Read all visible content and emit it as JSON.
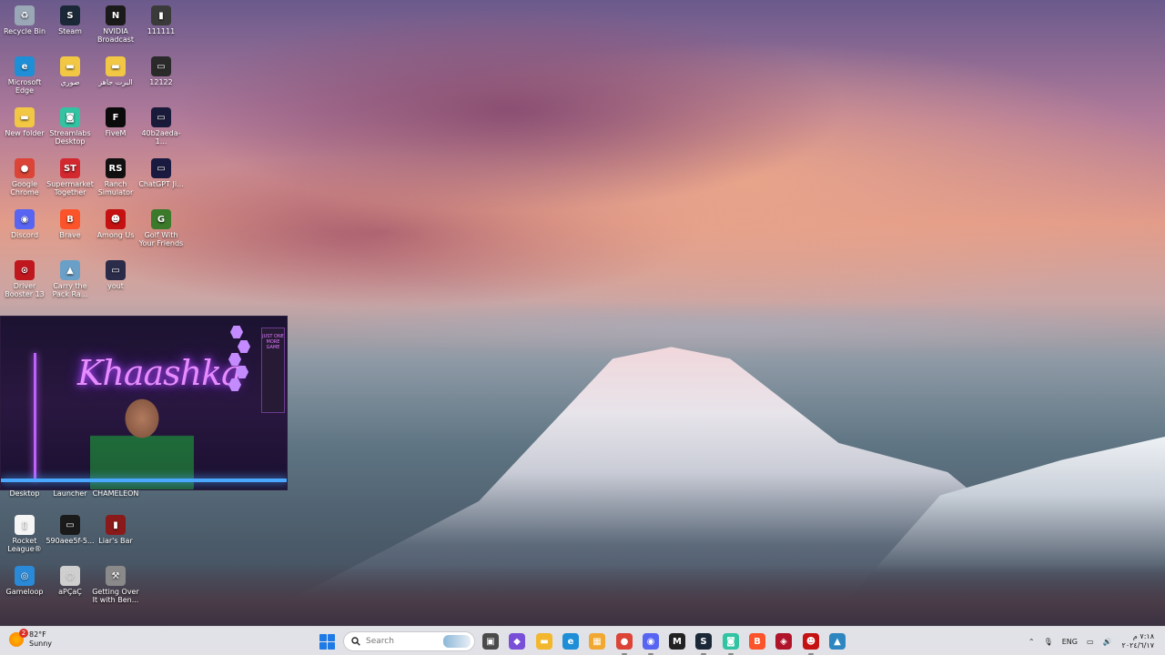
{
  "desktop": {
    "col1": [
      {
        "name": "recycle-bin",
        "label": "Recycle Bin",
        "glyph": "♻",
        "color": "#9aa7b6"
      },
      {
        "name": "microsoft-edge",
        "label": "Microsoft Edge",
        "glyph": "e",
        "color": "#1e8fd6"
      },
      {
        "name": "new-folder",
        "label": "New folder",
        "glyph": "▬",
        "color": "#f2c744"
      },
      {
        "name": "google-chrome",
        "label": "Google Chrome",
        "glyph": "●",
        "color": "#db4437"
      },
      {
        "name": "discord",
        "label": "Discord",
        "glyph": "◉",
        "color": "#5865f2"
      },
      {
        "name": "driver-booster",
        "label": "Driver Booster 13",
        "glyph": "⊙",
        "color": "#c0171f"
      }
    ],
    "col2": [
      {
        "name": "steam",
        "label": "Steam",
        "glyph": "S",
        "color": "#1b2838"
      },
      {
        "name": "folder-sowari",
        "label": "صوري",
        "glyph": "▬",
        "color": "#f2c744"
      },
      {
        "name": "streamlabs",
        "label": "Streamlabs Desktop",
        "glyph": "◙",
        "color": "#31c3a2"
      },
      {
        "name": "supermarket-together",
        "label": "Supermarket Together",
        "glyph": "ST",
        "color": "#d3282f"
      },
      {
        "name": "brave",
        "label": "Brave",
        "glyph": "B",
        "color": "#fb542b"
      },
      {
        "name": "carry-the-pack",
        "label": "Carry the Pack Ra...",
        "glyph": "▲",
        "color": "#6aa0c8"
      }
    ],
    "col3": [
      {
        "name": "nvidia-broadcast",
        "label": "NVIDIA Broadcast",
        "glyph": "N",
        "color": "#1a1a1a"
      },
      {
        "name": "folder-albirt",
        "label": "البرت جاهز",
        "glyph": "▬",
        "color": "#f2c744"
      },
      {
        "name": "fivem",
        "label": "FiveM",
        "glyph": "F",
        "color": "#0b0b0b"
      },
      {
        "name": "ranch-simulator",
        "label": "Ranch Simulator",
        "glyph": "RS",
        "color": "#111111"
      },
      {
        "name": "among-us",
        "label": "Among Us",
        "glyph": "☻",
        "color": "#c51111"
      },
      {
        "name": "yout",
        "label": "yout",
        "glyph": "▭",
        "color": "#2b2b4a"
      }
    ],
    "col4": [
      {
        "name": "file-111111",
        "label": "111111",
        "glyph": "▮",
        "color": "#3a3a3a"
      },
      {
        "name": "file-12122",
        "label": "12122",
        "glyph": "▭",
        "color": "#2a2a2a"
      },
      {
        "name": "file-40b",
        "label": "40b2aeda-1...",
        "glyph": "▭",
        "color": "#1a1a3a"
      },
      {
        "name": "chatgpt",
        "label": "ChatGPT Ji...",
        "glyph": "▭",
        "color": "#1a1a40"
      },
      {
        "name": "golf-with-friends",
        "label": "Golf With Your Friends",
        "glyph": "G",
        "color": "#3a7a2a"
      }
    ],
    "lower": [
      {
        "name": "desktop-partial",
        "label": "Desktop",
        "glyph": "",
        "color": "transparent"
      },
      {
        "name": "epic-launcher",
        "label": "Launcher",
        "glyph": "",
        "color": "transparent"
      },
      {
        "name": "chameleon",
        "label": "CHAMELEON",
        "glyph": "",
        "color": "transparent"
      },
      {
        "name": "rocket-league",
        "label": "Rocket League®",
        "glyph": "▯",
        "color": "#f5f5f5"
      },
      {
        "name": "file-590aee",
        "label": "590aee5f-5...",
        "glyph": "▭",
        "color": "#1a1a1a"
      },
      {
        "name": "liars-bar",
        "label": "Liar's Bar",
        "glyph": "▮",
        "color": "#8a1a1a"
      },
      {
        "name": "gameloop",
        "label": "Gameloop",
        "glyph": "◎",
        "color": "#2a8ad8"
      },
      {
        "name": "apcac",
        "label": "aPÇaÇ",
        "glyph": "◌",
        "color": "#cfcfcf"
      },
      {
        "name": "getting-over-it",
        "label": "Getting Over It with Ben...",
        "glyph": "⚒",
        "color": "#8a8a8a"
      }
    ]
  },
  "webcam": {
    "sign": "Khaashka",
    "poster": "JUST ONE MORE GAME"
  },
  "taskbar": {
    "weather_temp": "82°F",
    "weather_cond": "Sunny",
    "weather_badge": "2",
    "search_placeholder": "Search",
    "apps": [
      {
        "name": "task-view",
        "glyph": "▣",
        "color": "#4a4a4a"
      },
      {
        "name": "microsoft-365",
        "glyph": "◆",
        "color": "#7a4fd8"
      },
      {
        "name": "file-explorer",
        "glyph": "▬",
        "color": "#f2b72c"
      },
      {
        "name": "edge",
        "glyph": "e",
        "color": "#1e8fd6"
      },
      {
        "name": "store",
        "glyph": "▦",
        "color": "#f0a830"
      },
      {
        "name": "chrome",
        "glyph": "●",
        "color": "#db4437"
      },
      {
        "name": "discord",
        "glyph": "◉",
        "color": "#5865f2"
      },
      {
        "name": "epic",
        "glyph": "M",
        "color": "#222222"
      },
      {
        "name": "steam",
        "glyph": "S",
        "color": "#1b2838"
      },
      {
        "name": "streamlabs",
        "glyph": "◙",
        "color": "#31c3a2"
      },
      {
        "name": "brave",
        "glyph": "B",
        "color": "#fb542b"
      },
      {
        "name": "app-red",
        "glyph": "◈",
        "color": "#b0142a"
      },
      {
        "name": "among-us",
        "glyph": "☻",
        "color": "#c51111"
      },
      {
        "name": "photos",
        "glyph": "▲",
        "color": "#2e86c1"
      }
    ],
    "tray_lang": "ENG",
    "clock_time": "٧:١٨ م",
    "clock_date": "٢٠٢٤/٦/١٧"
  }
}
